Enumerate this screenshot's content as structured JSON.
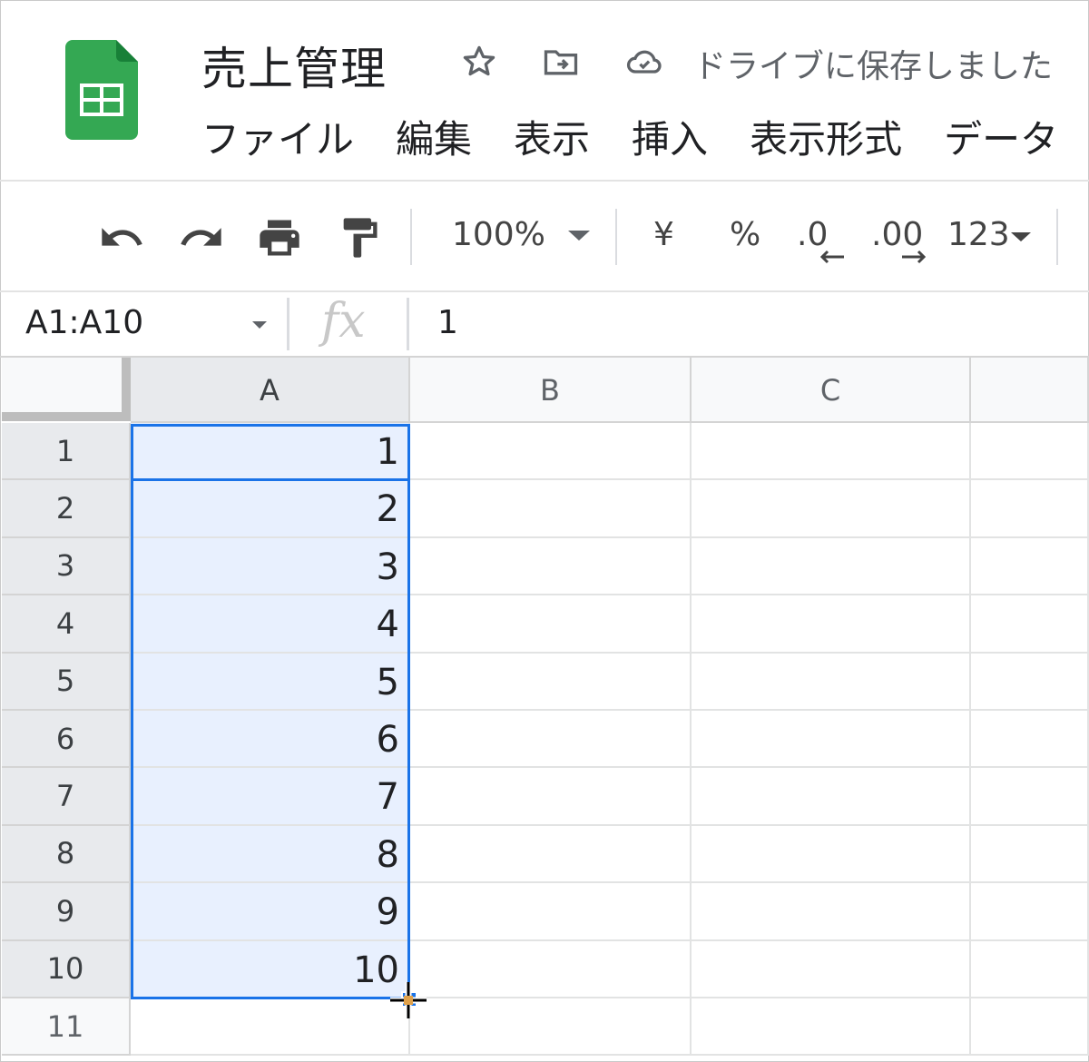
{
  "header": {
    "title": "売上管理",
    "save_status": "ドライブに保存しました",
    "brand_color": "#34a853",
    "icons": [
      "sheets-logo-icon",
      "star-icon",
      "move-to-folder-icon",
      "cloud-saved-icon"
    ]
  },
  "menu": {
    "items": [
      "ファイル",
      "編集",
      "表示",
      "挿入",
      "表示形式",
      "データ"
    ]
  },
  "toolbar": {
    "zoom": "100%",
    "currency": "¥",
    "percent": "%",
    "decrease_decimal": ".0",
    "increase_decimal": ".00",
    "more_formats": "123",
    "icons": [
      "undo-icon",
      "redo-icon",
      "print-icon",
      "paint-format-icon",
      "dropdown-caret-icon"
    ]
  },
  "formula_bar": {
    "name_box": "A1:A10",
    "fx": "fx",
    "value": "1"
  },
  "grid": {
    "columns": [
      "A",
      "B",
      "C"
    ],
    "rows": [
      "1",
      "2",
      "3",
      "4",
      "5",
      "6",
      "7",
      "8",
      "9",
      "10",
      "11"
    ],
    "column_a_values": [
      "1",
      "2",
      "3",
      "4",
      "5",
      "6",
      "7",
      "8",
      "9",
      "10",
      ""
    ],
    "selection": "A1:A10",
    "selection_color": "#1a73e8",
    "selection_fill": "#e8f0fe"
  }
}
